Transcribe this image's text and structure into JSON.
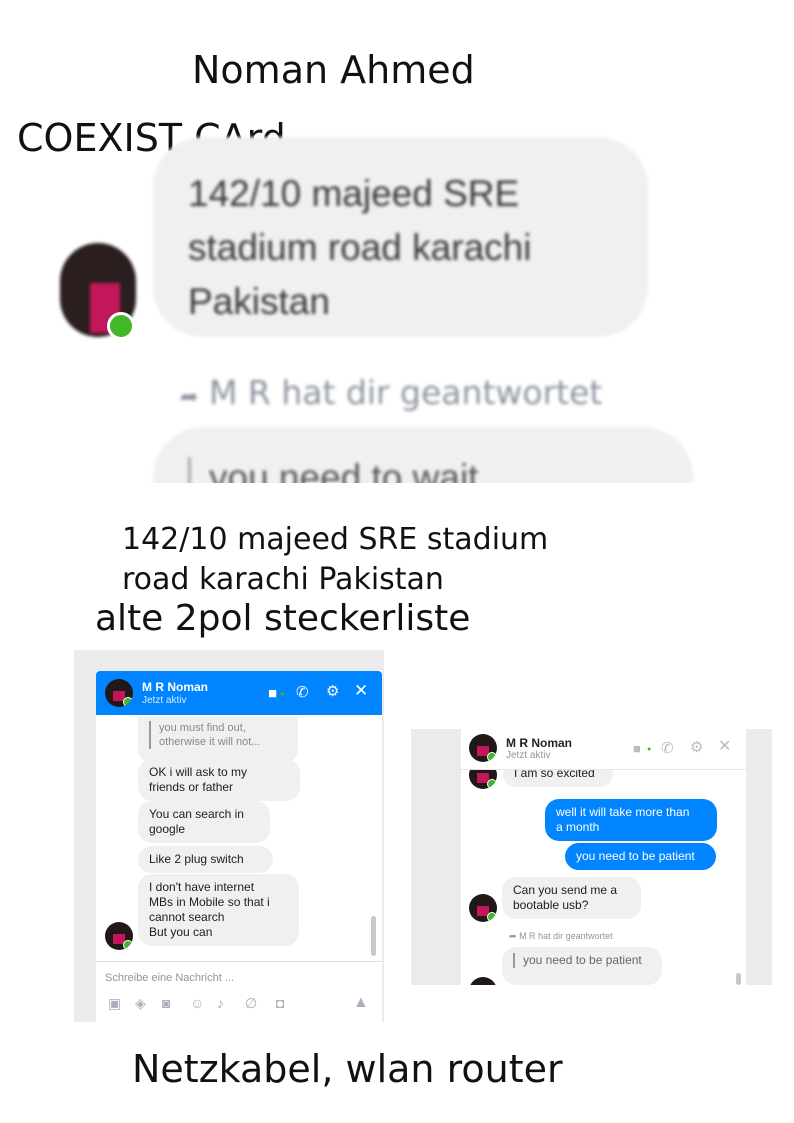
{
  "page": {
    "name": "Noman Ahmed",
    "card": "COEXIST CArd",
    "address_line1": "142/10 majeed SRE stadium",
    "address_line2": "road karachi Pakistan",
    "item_note": "alte 2pol steckerliste",
    "footer_note": "Netzkabel, wlan router"
  },
  "zoom": {
    "bubble_line1": "142/10 majeed SRE",
    "bubble_line2": "stadium road karachi",
    "bubble_line3": "Pakistan",
    "reply_notice": "M R hat dir geantwortet",
    "quoted_partial": "you need to wait"
  },
  "chat_left": {
    "contact_name": "M R Noman",
    "status": "Jetzt aktiv",
    "quote_line1": "you must find out,",
    "quote_line2": "otherwise it will not...",
    "messages": [
      {
        "line1": "OK i will ask to my",
        "line2": "friends or father"
      },
      {
        "line1": "You can search in",
        "line2": "google"
      },
      {
        "line1": "Like 2 plug switch"
      },
      {
        "line1": "I don't  have internet",
        "line2": "MBs in Mobile so that i",
        "line3": "cannot search",
        "line4": "But you can"
      }
    ],
    "composer_placeholder": "Schreibe eine Nachricht ...",
    "toolbar_icons": [
      "image-icon",
      "sticker-icon",
      "gif-icon",
      "emoji-icon",
      "game-icon",
      "attach-icon",
      "camera-icon"
    ],
    "like_icon": "thumbs-up-icon"
  },
  "chat_right": {
    "contact_name": "M R Noman",
    "status": "Jetzt aktiv",
    "msg_excited": "I am so excited",
    "msg_month_line1": "well it will take more than",
    "msg_month_line2": "a month",
    "msg_patient": "you need to be patient",
    "msg_usb_line1": "Can you send me a",
    "msg_usb_line2": "bootable usb?",
    "reply_notice": "M R hat dir geantwortet",
    "quoted": "you need to be patient"
  },
  "colors": {
    "messenger_blue": "#0084ff",
    "bubble_grey": "#f1f0f0",
    "online_green": "#42b72a",
    "panel_grey": "#ebebeb"
  }
}
